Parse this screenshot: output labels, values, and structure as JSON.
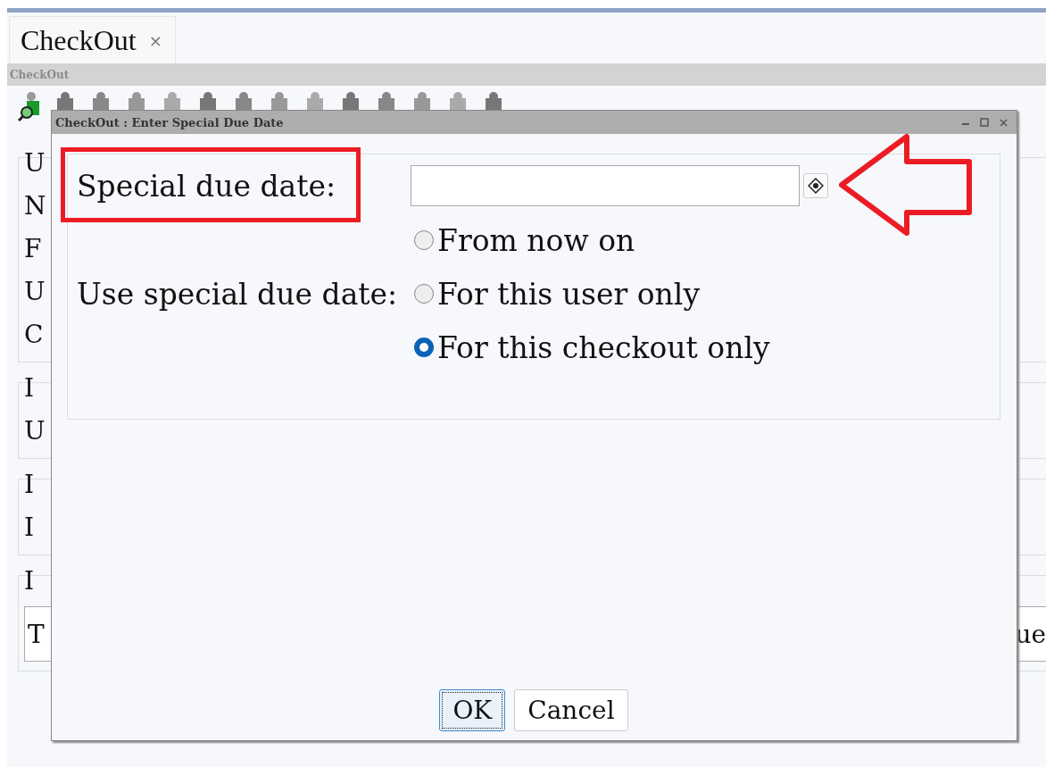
{
  "tabs": [
    {
      "label": "CheckOut",
      "close": "×"
    }
  ],
  "panel_title": "CheckOut",
  "background_groups": [
    {
      "legend": "U",
      "lines": [
        "N",
        "F",
        "U",
        "C"
      ]
    },
    {
      "legend": "I",
      "lines": [
        "U"
      ]
    },
    {
      "legend": "I",
      "lines": [
        "I"
      ]
    },
    {
      "legend": "I",
      "table_header": [
        "T",
        "ue"
      ]
    }
  ],
  "dialog": {
    "title": "CheckOut : Enter Special Due Date",
    "due_date_label": "Special due date:",
    "use_label": "Use special due date:",
    "options": [
      {
        "label": "From now on",
        "selected": false
      },
      {
        "label": "For this user only",
        "selected": false
      },
      {
        "label": "For this checkout only",
        "selected": true
      }
    ],
    "buttons": [
      {
        "label": "OK",
        "focused": true
      },
      {
        "label": "Cancel",
        "focused": false
      }
    ]
  }
}
